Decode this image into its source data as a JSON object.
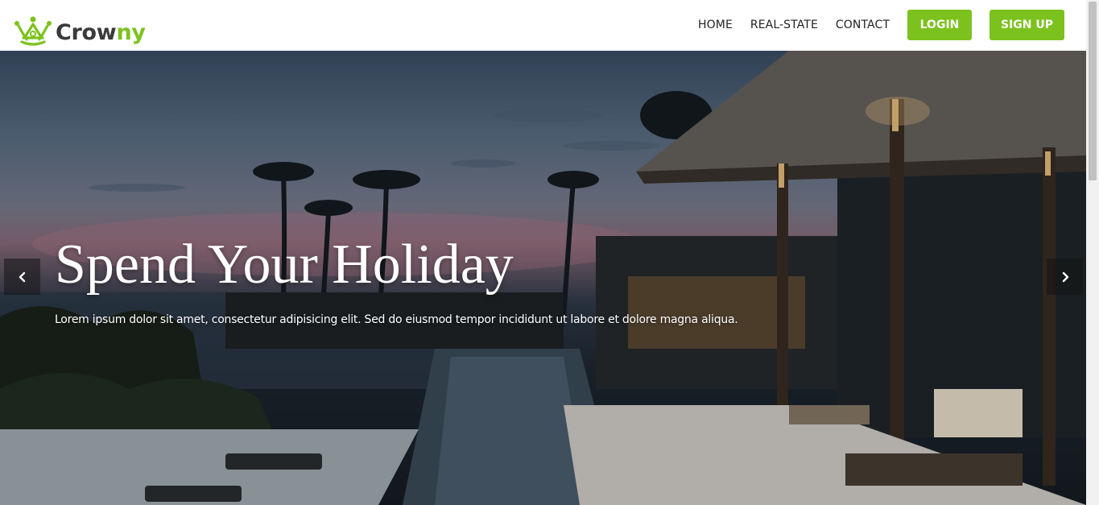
{
  "brand": {
    "name_part1": "Crow",
    "name_part2": "ny",
    "logo_icon": "crown-icon",
    "colors": {
      "primary": "#7cc21e",
      "dark": "#3a3a3a"
    }
  },
  "nav": {
    "items": [
      {
        "label": "HOME"
      },
      {
        "label": "REAL-STATE"
      },
      {
        "label": "CONTACT"
      }
    ],
    "login_label": "LOGIN",
    "signup_label": "SIGN UP"
  },
  "hero": {
    "title": "Spend Your Holiday",
    "subtitle": "Lorem ipsum dolor sit amet, consectetur adipisicing elit. Sed do eiusmod tempor incididunt ut labore et dolore magna aliqua.",
    "prev_icon": "chevron-left-icon",
    "next_icon": "chevron-right-icon"
  }
}
